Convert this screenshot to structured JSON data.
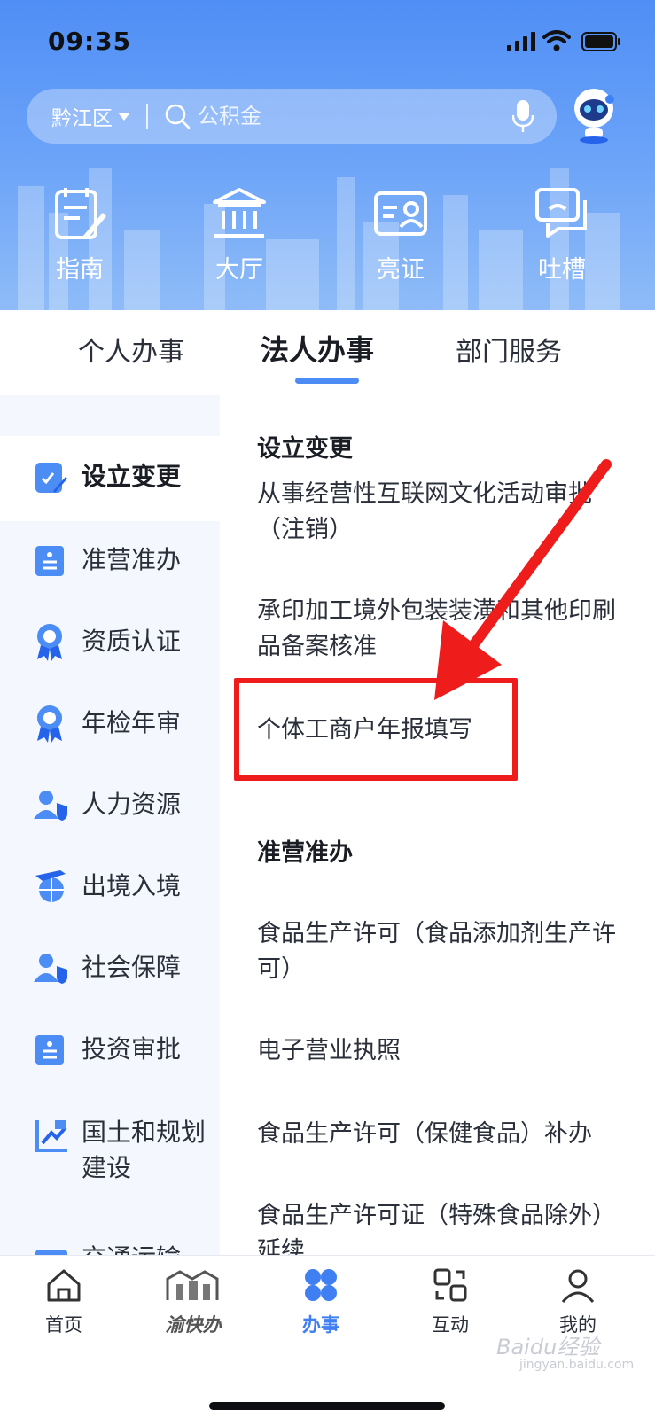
{
  "status_bar": {
    "time": "09:35"
  },
  "search": {
    "region": "黔江区",
    "placeholder": "公积金"
  },
  "quick_actions": [
    {
      "label": "指南",
      "icon": "guide-icon"
    },
    {
      "label": "大厅",
      "icon": "hall-icon"
    },
    {
      "label": "亮证",
      "icon": "id-card-icon"
    },
    {
      "label": "吐槽",
      "icon": "feedback-icon"
    }
  ],
  "tabs": [
    {
      "label": "个人办事",
      "active": false
    },
    {
      "label": "法人办事",
      "active": true
    },
    {
      "label": "部门服务",
      "active": false
    }
  ],
  "sidebar": {
    "items": [
      {
        "label": "设立变更",
        "active": true
      },
      {
        "label": "准营准办"
      },
      {
        "label": "资质认证"
      },
      {
        "label": "年检年审"
      },
      {
        "label": "人力资源"
      },
      {
        "label": "出境入境"
      },
      {
        "label": "社会保障"
      },
      {
        "label": "投资审批"
      },
      {
        "label": "国土和规划建设"
      },
      {
        "label": "交通运输"
      }
    ]
  },
  "main": {
    "sections": [
      {
        "title": "设立变更",
        "items": [
          "从事经营性互联网文化活动审批（注销）",
          "承印加工境外包装装潢和其他印刷品备案核准",
          "个体工商户年报填写"
        ]
      },
      {
        "title": "准营准办",
        "items": [
          "食品生产许可（食品添加剂生产许可）",
          "电子营业执照",
          "食品生产许可（保健食品）补办",
          "食品生产许可证（特殊食品除外）延续"
        ]
      }
    ]
  },
  "bottom_nav": [
    {
      "label": "首页",
      "icon": "home-icon"
    },
    {
      "label": "渝快办",
      "icon": "yukuaiban-logo"
    },
    {
      "label": "办事",
      "icon": "services-icon",
      "active": true
    },
    {
      "label": "互动",
      "icon": "interact-icon"
    },
    {
      "label": "我的",
      "icon": "profile-icon"
    }
  ],
  "watermark": {
    "text": "Baidu经验",
    "sub": "jingyan.baidu.com"
  },
  "colors": {
    "accent": "#4b8cf5",
    "highlight": "#ef1c1c",
    "header": "#5b96f6"
  }
}
